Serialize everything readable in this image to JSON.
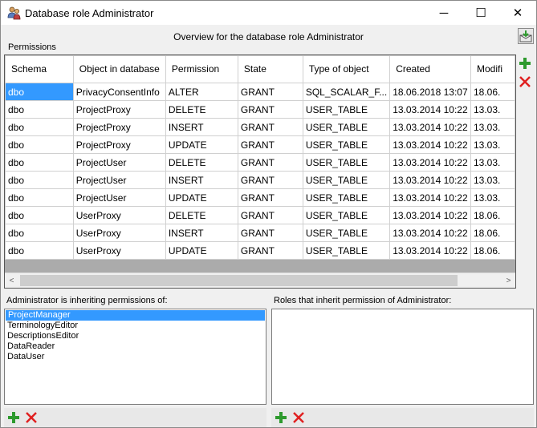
{
  "window": {
    "title": "Database role Administrator",
    "minimize_glyph": "─",
    "maximize_glyph": "☐",
    "close_glyph": "✕"
  },
  "overview": "Overview for the database role Administrator",
  "permissions_label": "Permissions",
  "grid": {
    "columns": [
      "Schema",
      "Object in database",
      "Permission",
      "State",
      "Type of object",
      "Created",
      "Modifi"
    ],
    "rows": [
      [
        "dbo",
        "PrivacyConsentInfo",
        "ALTER",
        "GRANT",
        "SQL_SCALAR_F...",
        "18.06.2018 13:07",
        "18.06."
      ],
      [
        "dbo",
        "ProjectProxy",
        "DELETE",
        "GRANT",
        "USER_TABLE",
        "13.03.2014 10:22",
        "13.03."
      ],
      [
        "dbo",
        "ProjectProxy",
        "INSERT",
        "GRANT",
        "USER_TABLE",
        "13.03.2014 10:22",
        "13.03."
      ],
      [
        "dbo",
        "ProjectProxy",
        "UPDATE",
        "GRANT",
        "USER_TABLE",
        "13.03.2014 10:22",
        "13.03."
      ],
      [
        "dbo",
        "ProjectUser",
        "DELETE",
        "GRANT",
        "USER_TABLE",
        "13.03.2014 10:22",
        "13.03."
      ],
      [
        "dbo",
        "ProjectUser",
        "INSERT",
        "GRANT",
        "USER_TABLE",
        "13.03.2014 10:22",
        "13.03."
      ],
      [
        "dbo",
        "ProjectUser",
        "UPDATE",
        "GRANT",
        "USER_TABLE",
        "13.03.2014 10:22",
        "13.03."
      ],
      [
        "dbo",
        "UserProxy",
        "DELETE",
        "GRANT",
        "USER_TABLE",
        "13.03.2014 10:22",
        "18.06."
      ],
      [
        "dbo",
        "UserProxy",
        "INSERT",
        "GRANT",
        "USER_TABLE",
        "13.03.2014 10:22",
        "18.06."
      ],
      [
        "dbo",
        "UserProxy",
        "UPDATE",
        "GRANT",
        "USER_TABLE",
        "13.03.2014 10:22",
        "18.06."
      ]
    ],
    "selected_cell": {
      "row": 0,
      "col": 0
    },
    "scroll_left_glyph": "<",
    "scroll_right_glyph": ">"
  },
  "inheriting": {
    "label": "Administrator is inheriting permissions of:",
    "items": [
      "ProjectManager",
      "TerminologyEditor",
      "DescriptionsEditor",
      "DataReader",
      "DataUser"
    ],
    "selected_index": 0
  },
  "inherited_by": {
    "label": "Roles that inherit permission of Administrator:",
    "items": []
  },
  "icons": {
    "add": "plus-icon",
    "remove": "delete-x-icon",
    "export": "export-icon",
    "title": "role-users-icon"
  },
  "colors": {
    "selection": "#3399ff",
    "add_green": "#2e9a2e",
    "delete_red": "#e02020"
  }
}
